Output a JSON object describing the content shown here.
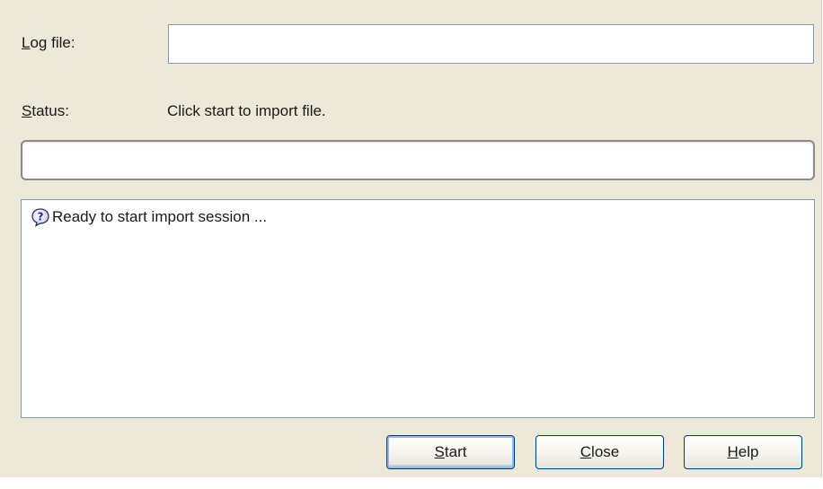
{
  "form": {
    "log_file_label_mnemonic": "L",
    "log_file_label_rest": "og file:",
    "log_file_value": "",
    "status_label_mnemonic": "S",
    "status_label_rest": "tatus:",
    "status_text": "Click start to import file."
  },
  "progress": {
    "percent": 0
  },
  "log": {
    "entries": [
      {
        "icon": "question-icon",
        "text": "Ready to start import session ..."
      }
    ]
  },
  "buttons": {
    "start_mnemonic": "S",
    "start_rest": "tart",
    "close_mnemonic": "C",
    "close_rest": "lose",
    "help_mnemonic": "H",
    "help_rest": "elp"
  },
  "colors": {
    "dialog_bg": "#ece9d8",
    "field_border": "#7f9db9",
    "button_border": "#003c74"
  }
}
